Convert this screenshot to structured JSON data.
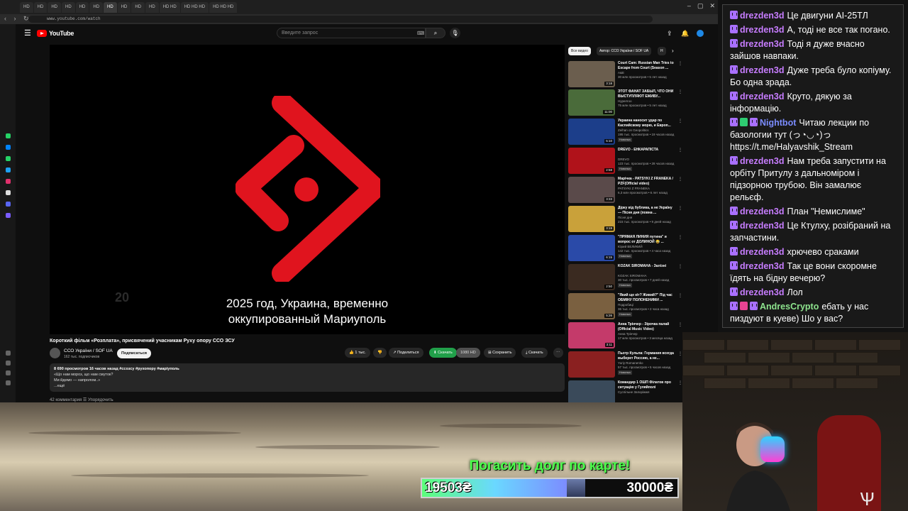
{
  "browser": {
    "tabs": [
      "HD",
      "HD",
      "HD",
      "HD",
      "HD",
      "HD",
      "HD",
      "HD",
      "HD",
      "HD",
      "HD HD",
      "HD HD HD",
      "HD HD HD"
    ],
    "url": "www.youtube.com/watch"
  },
  "youtube": {
    "logo_text": "YouTube",
    "search_placeholder": "Введите запрос",
    "video": {
      "watermark": "20",
      "subtitle_line1": "2025 год, Украина, временно",
      "subtitle_line2": "оккупированный Мариуполь",
      "title": "Короткий фільм «Розплата», присвячений учасникам Руху опору ССО ЗСУ",
      "channel": "ССО України / SOF UA",
      "subscribers": "162 тыс. подписчиков",
      "subscribe_label": "Подписаться",
      "likes": "1 тыс.",
      "share_label": "Поделиться",
      "download_label": "Скачать",
      "save_label": "Сохранить",
      "clip_label": "Скачать",
      "hd_pill": "1080 HD",
      "description_stats": "8 690 просмотров  16 часов назад  #ссозсу #рухопору #маріуполь",
      "description_line1": "«Що нам мороз, що нам смуток?",
      "description_line2": "Ми йдемо — напролом..»",
      "description_more": "...ещё",
      "comments_peek": "42 комментария     ☰ Упорядочить"
    },
    "chips": [
      "Все видео",
      "Автор: ССО України / SOF UA",
      "Н"
    ],
    "recommendations": [
      {
        "title": "Court Cam: Russian Man Tries to Escape from Court (Season ...",
        "channel": "A&E",
        "meta": "30 млн просмотров • 5 лет назад",
        "duration": "3:18",
        "badge": "",
        "color": "#6b5e4e"
      },
      {
        "title": "ЭТОТ ФАНАТ ЗАБЫЛ, ЧТО ОНИ ВЫСТУПЛЯЮТ ЕЖИВУ...",
        "channel": "Нурелгоо",
        "meta": "75 млн просмотров • 5 лет назад",
        "duration": "11:00",
        "badge": "",
        "color": "#4a6b3a"
      },
      {
        "title": "Украина наносит удар по Каспийскому морю, и Европ...",
        "channel": "Zeihan on Geopolitics",
        "meta": "195 тыс. просмотров • 19 часов назад",
        "duration": "5:10",
        "badge": "Новинка",
        "color": "#1c3e8a"
      },
      {
        "title": "DREVO - ЕНКАРАПІСТА",
        "channel": "DREVO",
        "meta": "123 тыс. просмотров • 28 часов назад",
        "duration": "2:58",
        "badge": "Новинка",
        "color": "#b0121a"
      },
      {
        "title": "Марічка - PATSYKI Z FRANEKA / PZF(Official video)",
        "channel": "PATSYKI Z FRANEKA",
        "meta": "6,3 млн просмотров • 6 лет назад",
        "duration": "3:33",
        "badge": "",
        "color": "#5a4a4a"
      },
      {
        "title": "Дірку від бублика, а не Україну — Пісня дня (повна ...",
        "channel": "Пісня дня",
        "meta": "215 тыс. просмотров • 9 дней назад",
        "duration": "3:19",
        "badge": "",
        "color": "#c9a13a"
      },
      {
        "title": "\"ПРЯМАЯ ЛИНИЯ путина\" и вопрос от ДОЛИНОЙ 😂 ...",
        "channel": "Юрий ВЕЛИКИЙ",
        "meta": "142 тыс. просмотров • 4 часа назад",
        "duration": "6:15",
        "badge": "Новинка",
        "color": "#2a4aa8"
      },
      {
        "title": "KOZAK SIROMAHA - Залізні",
        "channel": "KOZAK SIROMAHA",
        "meta": "30 тыс. просмотров • 7 дней назад",
        "duration": "2:50",
        "badge": "Новинка",
        "color": "#3a2a20"
      },
      {
        "title": "\"Який ще кіт? Живий?\" Під час ОБМІНУ ПОЛОНЕНИМИ ...",
        "channel": "Подробиці",
        "meta": "36 тыс. просмотров • 2 часа назад",
        "duration": "5:26",
        "badge": "Новинка",
        "color": "#7a6040"
      },
      {
        "title": "Анна Трінчер - Зірочка палай (Official Music Video)",
        "channel": "Анна Трінчер",
        "meta": "17 млн просмотров • 3 месяца назад",
        "duration": "3:11",
        "badge": "",
        "color": "#c43a6a"
      },
      {
        "title": "Пьотр Кульпа: Германия всегда выберет Россию, а не...",
        "channel": "Yuriy Romanenko",
        "meta": "57 тыс. просмотров • 5 часов назад",
        "duration": "",
        "badge": "Новинка",
        "color": "#8a2020"
      },
      {
        "title": "Командир 1 ОШП Філатов про ситуацію у Гуляйполі",
        "channel": "Суспільне Запоріжжя",
        "meta": "",
        "duration": "",
        "badge": "",
        "color": "#3a4a5a"
      }
    ]
  },
  "chat": [
    {
      "user": "drezden3d",
      "text": "Це двигуни АІ-25ТЛ",
      "badges": [
        "tw"
      ],
      "style": ""
    },
    {
      "user": "drezden3d",
      "text": "А, тоді не все так погано.",
      "badges": [
        "tw"
      ],
      "style": ""
    },
    {
      "user": "drezden3d",
      "text": "Тоді я дуже вчасно зайшов навпаки.",
      "badges": [
        "tw"
      ],
      "style": ""
    },
    {
      "user": "drezden3d",
      "text": "Дуже треба було копіуму. Бо одна зрада.",
      "badges": [
        "tw"
      ],
      "style": ""
    },
    {
      "user": "drezden3d",
      "text": "Круто, дякую за інформацію.",
      "badges": [
        "tw"
      ],
      "style": ""
    },
    {
      "user": "Nightbot",
      "text": "Читаю лекции по базологии тут (っ◔◡◔)っ https://t.me/Halyavshik_Stream",
      "badges": [
        "tw",
        "green",
        "tw"
      ],
      "style": "blue"
    },
    {
      "user": "drezden3d",
      "text": "Нам треба запустити на орбіту Притулу з дальноміром і підзорною трубою. Він замалює рельєф.",
      "badges": [
        "tw"
      ],
      "style": ""
    },
    {
      "user": "drezden3d",
      "text": "План \"Немислиме\"",
      "badges": [
        "tw"
      ],
      "style": ""
    },
    {
      "user": "drezden3d",
      "text": "Це Ктулху, розібраний на запчастини.",
      "badges": [
        "tw"
      ],
      "style": ""
    },
    {
      "user": "drezden3d",
      "text": "хрючево сраками",
      "badges": [
        "tw"
      ],
      "style": ""
    },
    {
      "user": "drezden3d",
      "text": "Так це вони скоромне їдять на бідну вечерю?",
      "badges": [
        "tw"
      ],
      "style": ""
    },
    {
      "user": "drezden3d",
      "text": "Лол",
      "badges": [
        "tw"
      ],
      "style": ""
    },
    {
      "user": "AndresCrypto",
      "text": "ебать у нас пиздуют в куеве) Шо у вас?",
      "badges": [
        "tw",
        "gift",
        "tw"
      ],
      "style": "green"
    }
  ],
  "donation": {
    "title": "Погасить долг по карте!",
    "current": "19503₴",
    "goal": "30000₴",
    "progress": 0.65
  },
  "colors": {
    "yt_red": "#ff0000",
    "logo_red": "#e0141e",
    "accent_green": "#4cff4c",
    "twitch_purple": "#a970ff"
  }
}
